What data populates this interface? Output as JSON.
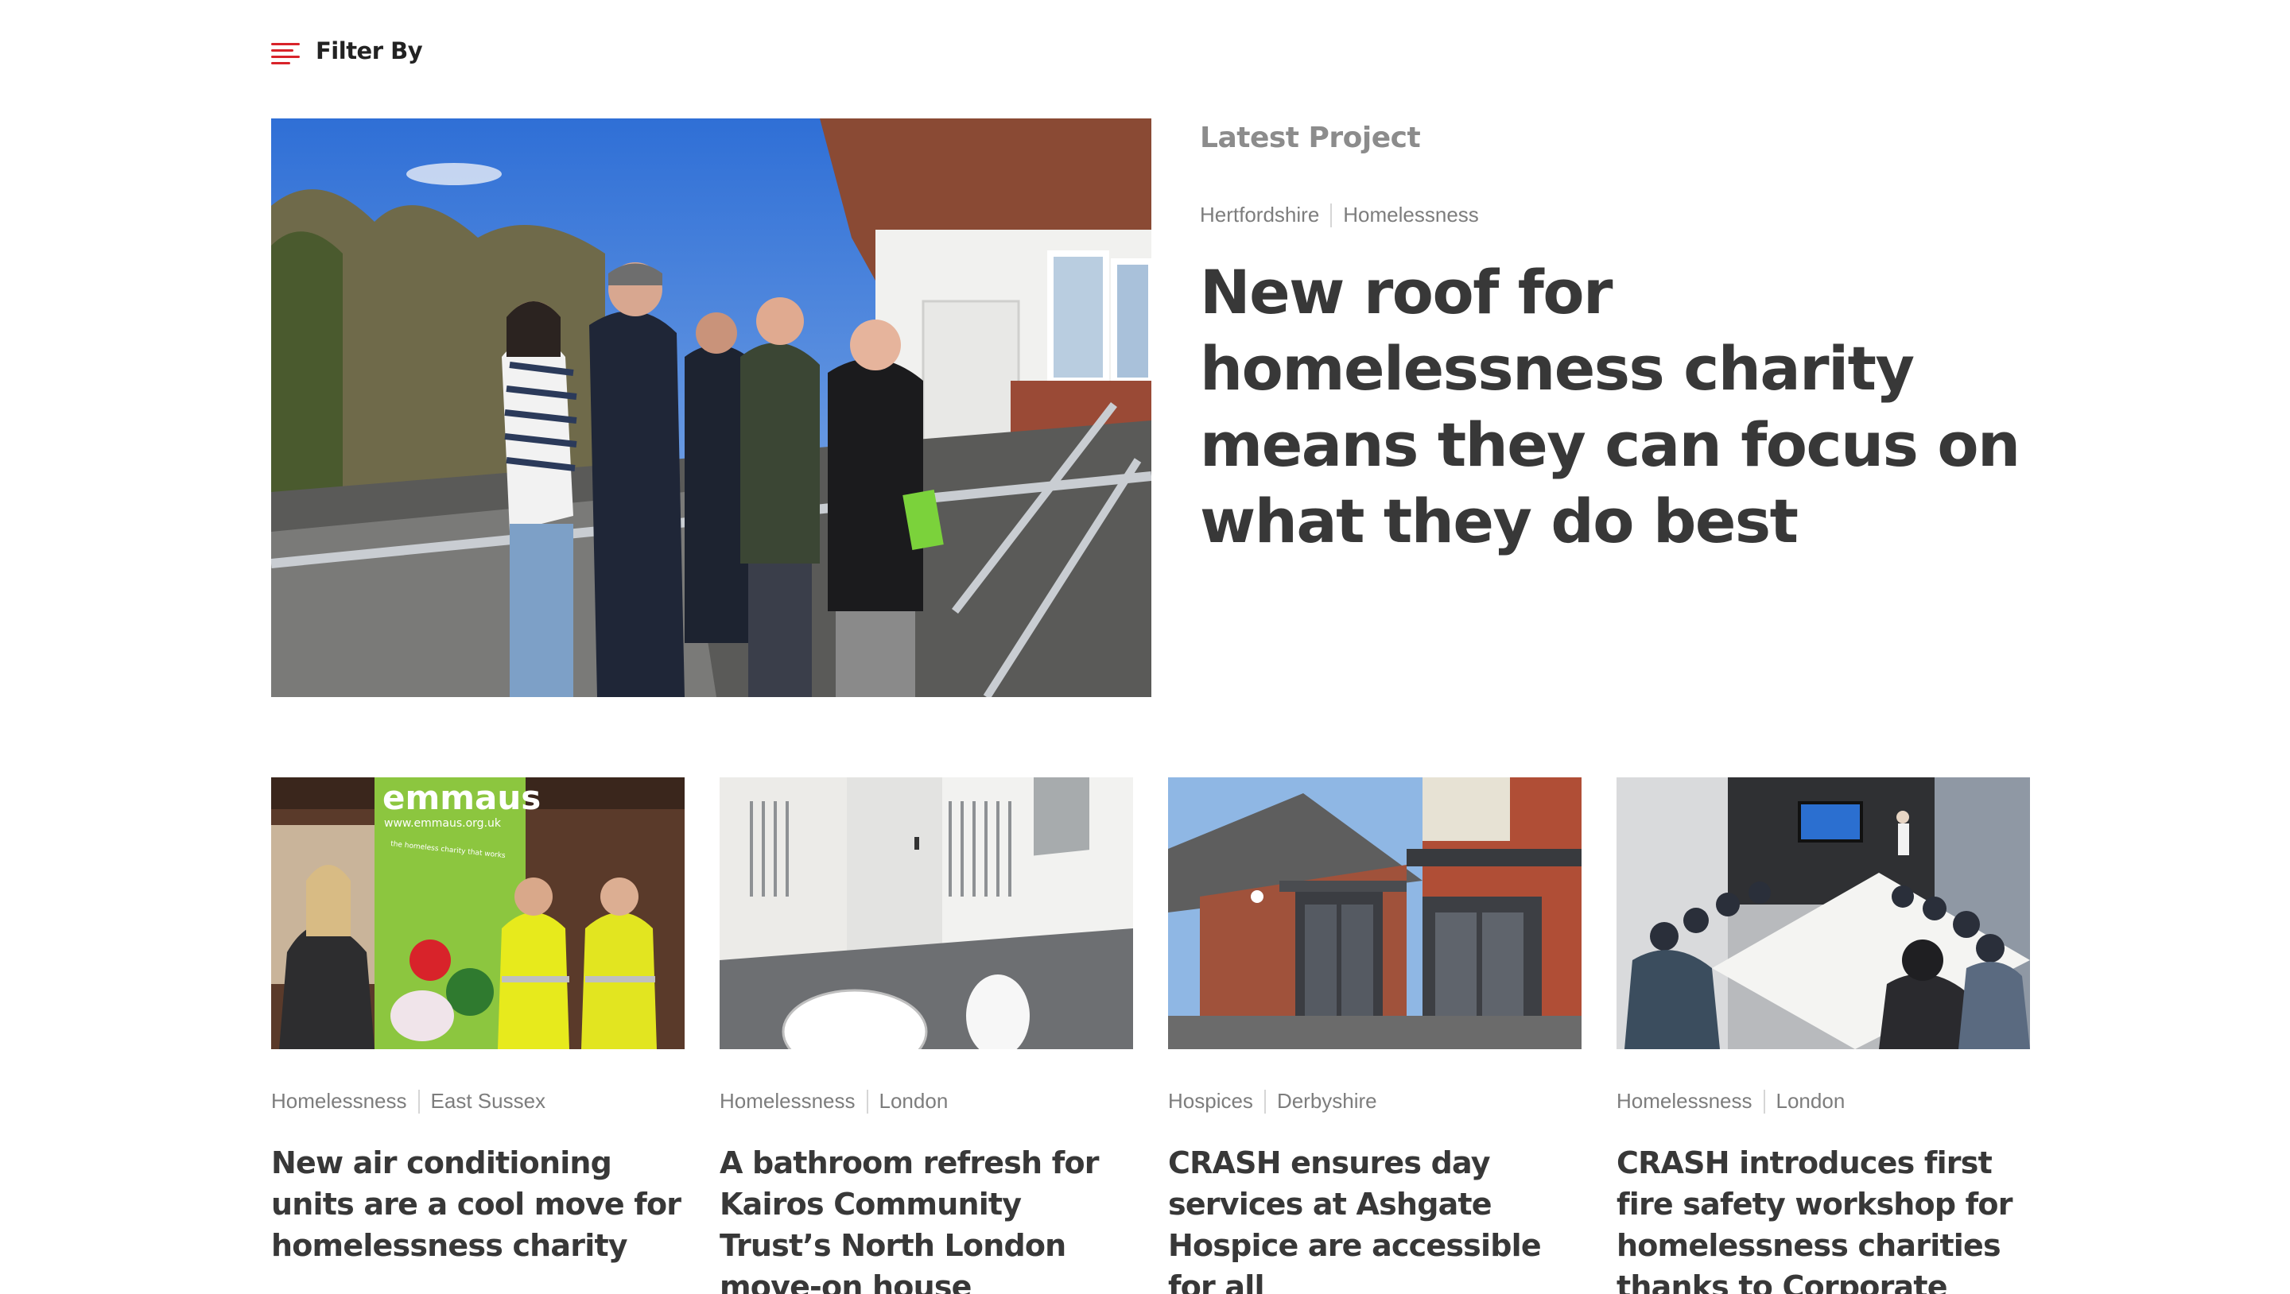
{
  "filter": {
    "label": "Filter By",
    "icon": "filter-lines-icon",
    "accent": "#d8232a"
  },
  "hero": {
    "section_label": "Latest Project",
    "tags": [
      "Hertfordshire",
      "Homelessness"
    ],
    "title": "New roof for homelessness charity means they can focus on what they do best"
  },
  "cards": [
    {
      "tags": [
        "Homelessness",
        "East Sussex"
      ],
      "title": "New air conditioning units are a cool move for homelessness charity",
      "banner_text": "emmaus",
      "banner_url": "www.emmaus.org.uk",
      "banner_tagline": "the homeless charity that works"
    },
    {
      "tags": [
        "Homelessness",
        "London"
      ],
      "title": "A bathroom refresh for Kairos Community Trust’s North London move-on house"
    },
    {
      "tags": [
        "Hospices",
        "Derbyshire"
      ],
      "title": "CRASH ensures day services at Ashgate Hospice are accessible for all"
    },
    {
      "tags": [
        "Homelessness",
        "London"
      ],
      "title": "CRASH introduces first fire safety workshop for homelessness charities thanks to Corporate Patron"
    }
  ]
}
